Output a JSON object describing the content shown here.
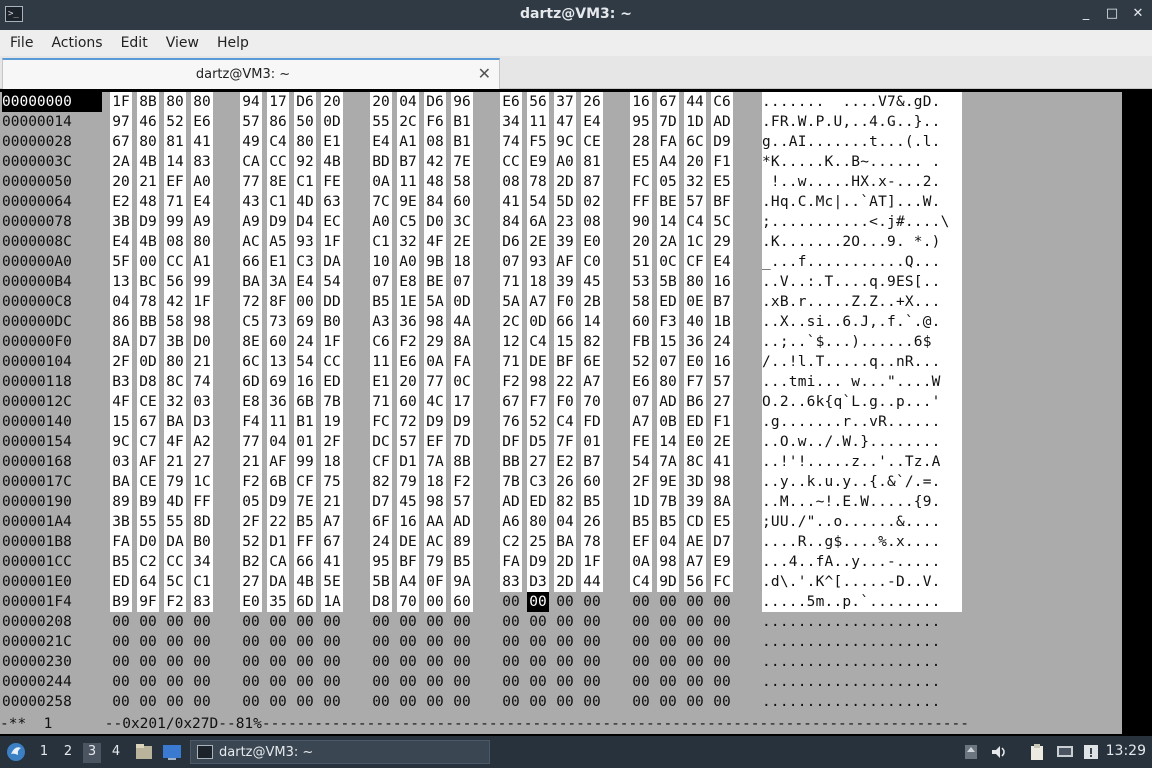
{
  "window": {
    "title": "dartz@VM3: ~",
    "controls": [
      "_",
      "□",
      "✕"
    ]
  },
  "menu": [
    "File",
    "Actions",
    "Edit",
    "View",
    "Help"
  ],
  "tab": {
    "label": "dartz@VM3: ~",
    "close": "✕"
  },
  "hex": {
    "rows": [
      {
        "addr": "00000000",
        "bytes": [
          "1F",
          "8B",
          "80",
          "80",
          "94",
          "17",
          "D6",
          "20",
          "20",
          "04",
          "D6",
          "96",
          "E6",
          "56",
          "37",
          "26",
          "16",
          "67",
          "44",
          "C6"
        ],
        "ascii": ".......  ....V7&.gD."
      },
      {
        "addr": "00000014",
        "bytes": [
          "97",
          "46",
          "52",
          "E6",
          "57",
          "86",
          "50",
          "0D",
          "55",
          "2C",
          "F6",
          "B1",
          "34",
          "11",
          "47",
          "E4",
          "95",
          "7D",
          "1D",
          "AD"
        ],
        "ascii": ".FR.W.P.U,..4.G..}.."
      },
      {
        "addr": "00000028",
        "bytes": [
          "67",
          "80",
          "81",
          "41",
          "49",
          "C4",
          "80",
          "E1",
          "E4",
          "A1",
          "08",
          "B1",
          "74",
          "F5",
          "9C",
          "CE",
          "28",
          "FA",
          "6C",
          "D9"
        ],
        "ascii": "g..AI.......t...(.l."
      },
      {
        "addr": "0000003C",
        "bytes": [
          "2A",
          "4B",
          "14",
          "83",
          "CA",
          "CC",
          "92",
          "4B",
          "BD",
          "B7",
          "42",
          "7E",
          "CC",
          "E9",
          "A0",
          "81",
          "E5",
          "A4",
          "20",
          "F1"
        ],
        "ascii": "*K.....K..B~...... ."
      },
      {
        "addr": "00000050",
        "bytes": [
          "20",
          "21",
          "EF",
          "A0",
          "77",
          "8E",
          "C1",
          "FE",
          "0A",
          "11",
          "48",
          "58",
          "08",
          "78",
          "2D",
          "87",
          "FC",
          "05",
          "32",
          "E5"
        ],
        "ascii": " !..w.....HX.x-...2."
      },
      {
        "addr": "00000064",
        "bytes": [
          "E2",
          "48",
          "71",
          "E4",
          "43",
          "C1",
          "4D",
          "63",
          "7C",
          "9E",
          "84",
          "60",
          "41",
          "54",
          "5D",
          "02",
          "FF",
          "BE",
          "57",
          "BF"
        ],
        "ascii": ".Hq.C.Mc|..`AT]...W."
      },
      {
        "addr": "00000078",
        "bytes": [
          "3B",
          "D9",
          "99",
          "A9",
          "A9",
          "D9",
          "D4",
          "EC",
          "A0",
          "C5",
          "D0",
          "3C",
          "84",
          "6A",
          "23",
          "08",
          "90",
          "14",
          "C4",
          "5C"
        ],
        "ascii": ";...........<.j#....\\"
      },
      {
        "addr": "0000008C",
        "bytes": [
          "E4",
          "4B",
          "08",
          "80",
          "AC",
          "A5",
          "93",
          "1F",
          "C1",
          "32",
          "4F",
          "2E",
          "D6",
          "2E",
          "39",
          "E0",
          "20",
          "2A",
          "1C",
          "29"
        ],
        "ascii": ".K.......2O...9. *.)"
      },
      {
        "addr": "000000A0",
        "bytes": [
          "5F",
          "00",
          "CC",
          "A1",
          "66",
          "E1",
          "C3",
          "DA",
          "10",
          "A0",
          "9B",
          "18",
          "07",
          "93",
          "AF",
          "C0",
          "51",
          "0C",
          "CF",
          "E4"
        ],
        "ascii": "_...f...........Q..."
      },
      {
        "addr": "000000B4",
        "bytes": [
          "13",
          "BC",
          "56",
          "99",
          "BA",
          "3A",
          "E4",
          "54",
          "07",
          "E8",
          "BE",
          "07",
          "71",
          "18",
          "39",
          "45",
          "53",
          "5B",
          "80",
          "16"
        ],
        "ascii": "..V..:.T....q.9ES[.."
      },
      {
        "addr": "000000C8",
        "bytes": [
          "04",
          "78",
          "42",
          "1F",
          "72",
          "8F",
          "00",
          "DD",
          "B5",
          "1E",
          "5A",
          "0D",
          "5A",
          "A7",
          "F0",
          "2B",
          "58",
          "ED",
          "0E",
          "B7"
        ],
        "ascii": ".xB.r.....Z.Z..+X..."
      },
      {
        "addr": "000000DC",
        "bytes": [
          "86",
          "BB",
          "58",
          "98",
          "C5",
          "73",
          "69",
          "B0",
          "A3",
          "36",
          "98",
          "4A",
          "2C",
          "0D",
          "66",
          "14",
          "60",
          "F3",
          "40",
          "1B"
        ],
        "ascii": "..X..si..6.J,.f.`.@."
      },
      {
        "addr": "000000F0",
        "bytes": [
          "8A",
          "D7",
          "3B",
          "D0",
          "8E",
          "60",
          "24",
          "1F",
          "C6",
          "F2",
          "29",
          "8A",
          "12",
          "C4",
          "15",
          "82",
          "FB",
          "15",
          "36",
          "24"
        ],
        "ascii": "..;..`$...)......6$"
      },
      {
        "addr": "00000104",
        "bytes": [
          "2F",
          "0D",
          "80",
          "21",
          "6C",
          "13",
          "54",
          "CC",
          "11",
          "E6",
          "0A",
          "FA",
          "71",
          "DE",
          "BF",
          "6E",
          "52",
          "07",
          "E0",
          "16"
        ],
        "ascii": "/..!l.T.....q..nR..."
      },
      {
        "addr": "00000118",
        "bytes": [
          "B3",
          "D8",
          "8C",
          "74",
          "6D",
          "69",
          "16",
          "ED",
          "E1",
          "20",
          "77",
          "0C",
          "F2",
          "98",
          "22",
          "A7",
          "E6",
          "80",
          "F7",
          "57"
        ],
        "ascii": "...tmi... w...\"....W"
      },
      {
        "addr": "0000012C",
        "bytes": [
          "4F",
          "CE",
          "32",
          "03",
          "E8",
          "36",
          "6B",
          "7B",
          "71",
          "60",
          "4C",
          "17",
          "67",
          "F7",
          "F0",
          "70",
          "07",
          "AD",
          "B6",
          "27"
        ],
        "ascii": "O.2..6k{q`L.g..p...'"
      },
      {
        "addr": "00000140",
        "bytes": [
          "15",
          "67",
          "BA",
          "D3",
          "F4",
          "11",
          "B1",
          "19",
          "FC",
          "72",
          "D9",
          "D9",
          "76",
          "52",
          "C4",
          "FD",
          "A7",
          "0B",
          "ED",
          "F1"
        ],
        "ascii": ".g.......r..vR......"
      },
      {
        "addr": "00000154",
        "bytes": [
          "9C",
          "C7",
          "4F",
          "A2",
          "77",
          "04",
          "01",
          "2F",
          "DC",
          "57",
          "EF",
          "7D",
          "DF",
          "D5",
          "7F",
          "01",
          "FE",
          "14",
          "E0",
          "2E"
        ],
        "ascii": "..O.w../.W.}........"
      },
      {
        "addr": "00000168",
        "bytes": [
          "03",
          "AF",
          "21",
          "27",
          "21",
          "AF",
          "99",
          "18",
          "CF",
          "D1",
          "7A",
          "8B",
          "BB",
          "27",
          "E2",
          "B7",
          "54",
          "7A",
          "8C",
          "41"
        ],
        "ascii": "..!'!.....z..'..Tz.A"
      },
      {
        "addr": "0000017C",
        "bytes": [
          "BA",
          "CE",
          "79",
          "1C",
          "F2",
          "6B",
          "CF",
          "75",
          "82",
          "79",
          "18",
          "F2",
          "7B",
          "C3",
          "26",
          "60",
          "2F",
          "9E",
          "3D",
          "98"
        ],
        "ascii": "..y..k.u.y..{.&`/.=."
      },
      {
        "addr": "00000190",
        "bytes": [
          "89",
          "B9",
          "4D",
          "FF",
          "05",
          "D9",
          "7E",
          "21",
          "D7",
          "45",
          "98",
          "57",
          "AD",
          "ED",
          "82",
          "B5",
          "1D",
          "7B",
          "39",
          "8A"
        ],
        "ascii": "..M...~!.E.W.....{9."
      },
      {
        "addr": "000001A4",
        "bytes": [
          "3B",
          "55",
          "55",
          "8D",
          "2F",
          "22",
          "B5",
          "A7",
          "6F",
          "16",
          "AA",
          "AD",
          "A6",
          "80",
          "04",
          "26",
          "B5",
          "B5",
          "CD",
          "E5"
        ],
        "ascii": ";UU./\"..o......&...."
      },
      {
        "addr": "000001B8",
        "bytes": [
          "FA",
          "D0",
          "DA",
          "B0",
          "52",
          "D1",
          "FF",
          "67",
          "24",
          "DE",
          "AC",
          "89",
          "C2",
          "25",
          "BA",
          "78",
          "EF",
          "04",
          "AE",
          "D7"
        ],
        "ascii": "....R..g$....%.x...."
      },
      {
        "addr": "000001CC",
        "bytes": [
          "B5",
          "C2",
          "CC",
          "34",
          "B2",
          "CA",
          "66",
          "41",
          "95",
          "BF",
          "79",
          "B5",
          "FA",
          "D9",
          "2D",
          "1F",
          "0A",
          "98",
          "A7",
          "E9"
        ],
        "ascii": "...4..fA..y...-....."
      },
      {
        "addr": "000001E0",
        "bytes": [
          "ED",
          "64",
          "5C",
          "C1",
          "27",
          "DA",
          "4B",
          "5E",
          "5B",
          "A4",
          "0F",
          "9A",
          "83",
          "D3",
          "2D",
          "44",
          "C4",
          "9D",
          "56",
          "FC"
        ],
        "ascii": ".d\\.'.K^[.....-D..V."
      },
      {
        "addr": "000001F4",
        "bytes": [
          "B9",
          "9F",
          "F2",
          "83",
          "E0",
          "35",
          "6D",
          "1A",
          "D8",
          "70",
          "00",
          "60",
          "00",
          "00",
          "00",
          "00",
          "00",
          "00",
          "00",
          "00"
        ],
        "ascii": ".....5m..p.`........"
      },
      {
        "addr": "00000208",
        "bytes": [
          "00",
          "00",
          "00",
          "00",
          "00",
          "00",
          "00",
          "00",
          "00",
          "00",
          "00",
          "00",
          "00",
          "00",
          "00",
          "00",
          "00",
          "00",
          "00",
          "00"
        ],
        "ascii": "...................."
      },
      {
        "addr": "0000021C",
        "bytes": [
          "00",
          "00",
          "00",
          "00",
          "00",
          "00",
          "00",
          "00",
          "00",
          "00",
          "00",
          "00",
          "00",
          "00",
          "00",
          "00",
          "00",
          "00",
          "00",
          "00"
        ],
        "ascii": "...................."
      },
      {
        "addr": "00000230",
        "bytes": [
          "00",
          "00",
          "00",
          "00",
          "00",
          "00",
          "00",
          "00",
          "00",
          "00",
          "00",
          "00",
          "00",
          "00",
          "00",
          "00",
          "00",
          "00",
          "00",
          "00"
        ],
        "ascii": "...................."
      },
      {
        "addr": "00000244",
        "bytes": [
          "00",
          "00",
          "00",
          "00",
          "00",
          "00",
          "00",
          "00",
          "00",
          "00",
          "00",
          "00",
          "00",
          "00",
          "00",
          "00",
          "00",
          "00",
          "00",
          "00"
        ],
        "ascii": "...................."
      },
      {
        "addr": "00000258",
        "bytes": [
          "00",
          "00",
          "00",
          "00",
          "00",
          "00",
          "00",
          "00",
          "00",
          "00",
          "00",
          "00",
          "00",
          "00",
          "00",
          "00",
          "00",
          "00",
          "00",
          "00"
        ],
        "ascii": "...................."
      }
    ],
    "modeline": "-**  1      --0x201/0x27D--81%---------------------------------------------------------------------------------"
  },
  "taskbar": {
    "workspaces": [
      "1",
      "2",
      "3",
      "4"
    ],
    "active_workspace": "3",
    "window_label": "dartz@VM3: ~",
    "clock": "13:29"
  }
}
